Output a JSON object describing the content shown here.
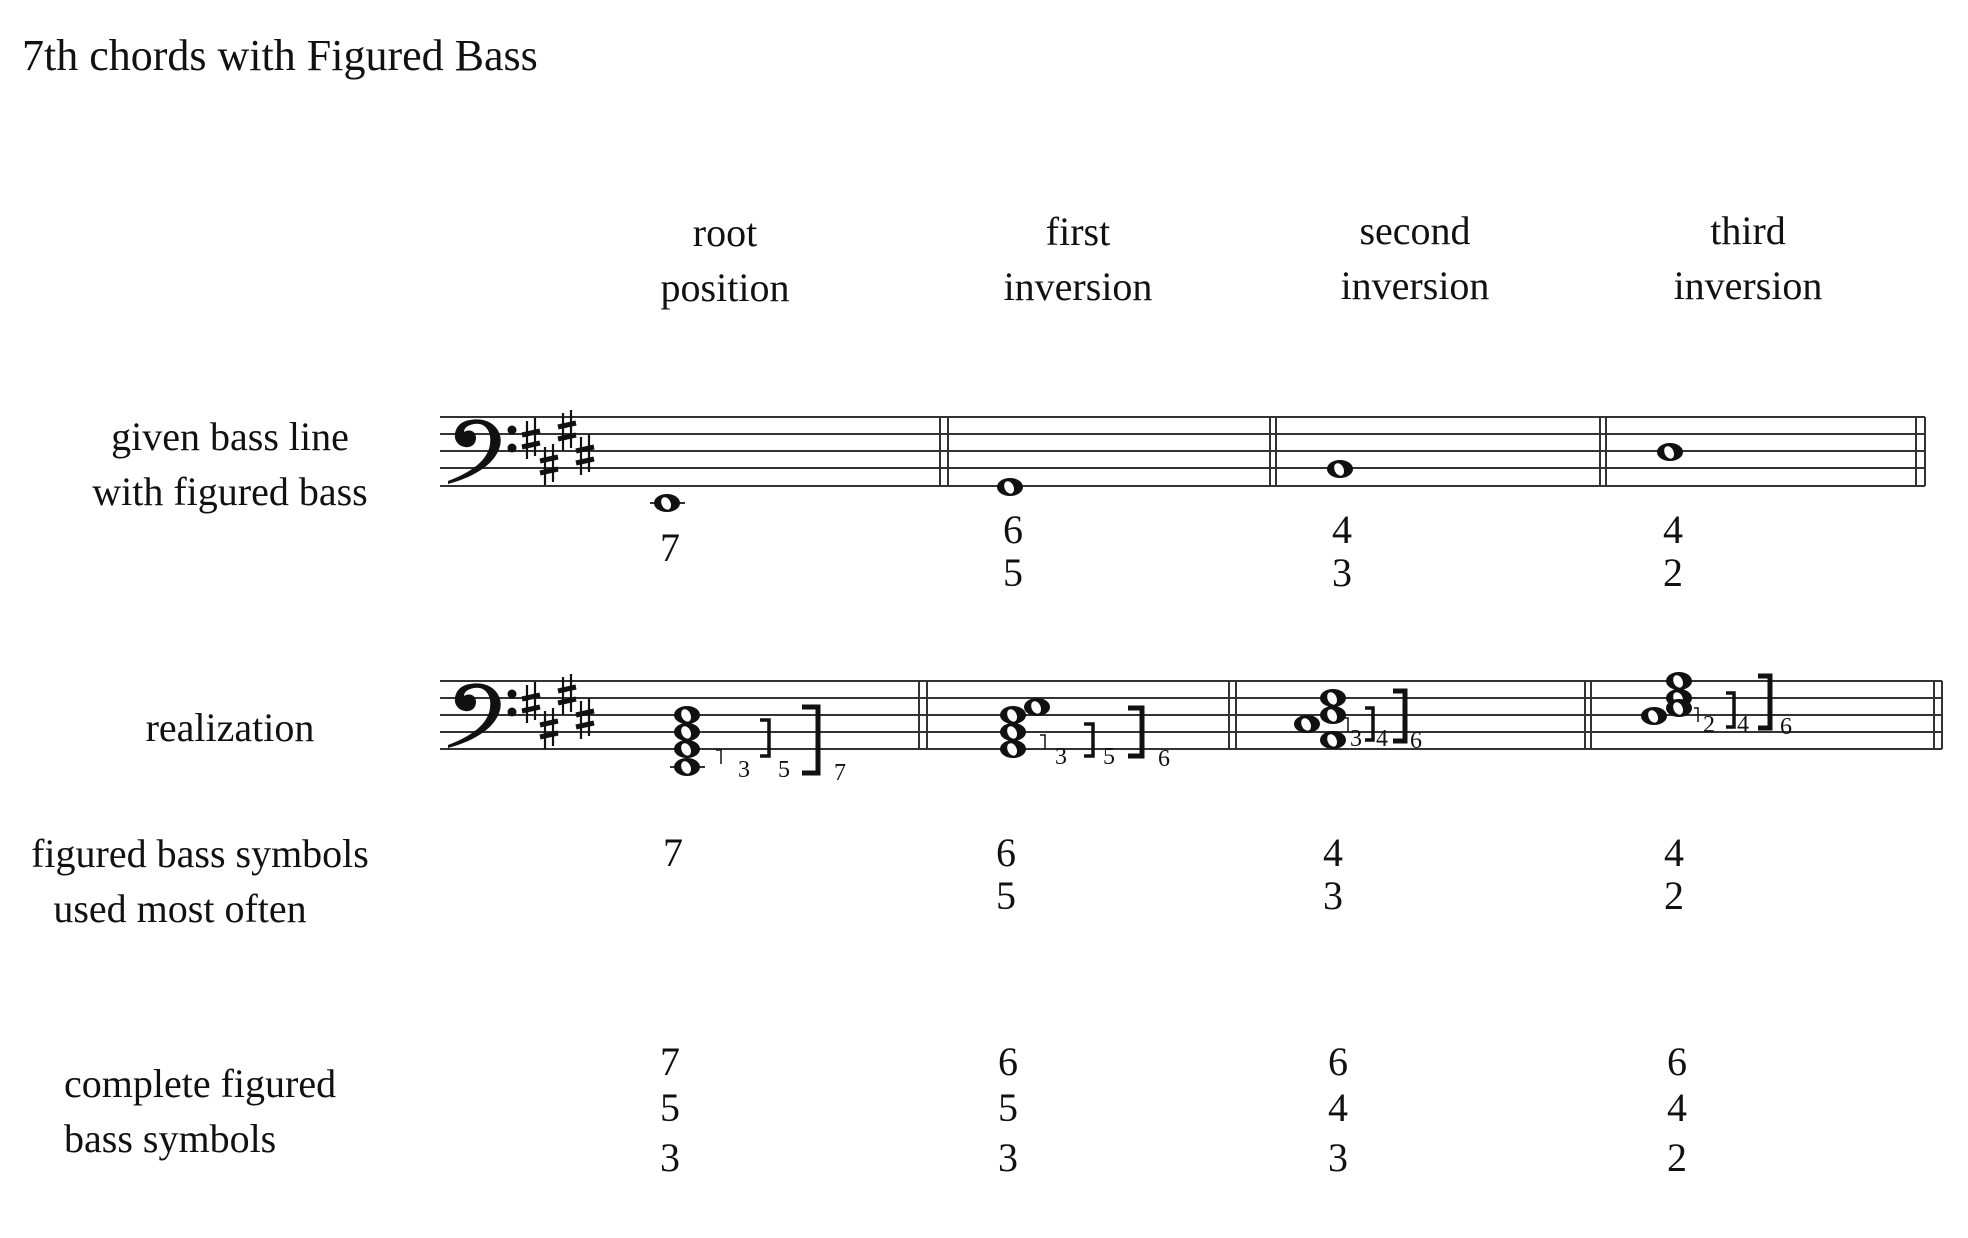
{
  "title": "7th chords with Figured Bass",
  "columns": [
    {
      "line1": "root",
      "line2": "position"
    },
    {
      "line1": "first",
      "line2": "inversion"
    },
    {
      "line1": "second",
      "line2": "inversion"
    },
    {
      "line1": "third",
      "line2": "inversion"
    }
  ],
  "rows": {
    "given": {
      "line1": "given bass line",
      "line2": "with figured bass"
    },
    "realization": {
      "line1": "realization"
    },
    "most_often": {
      "line1": "figured bass symbols",
      "line2": "used most often"
    },
    "complete": {
      "line1": "complete figured",
      "line2": "bass symbols"
    }
  },
  "clef": "bass-clef",
  "key_signature": "4 sharps (E major / C# minor)",
  "given_figures": [
    [
      "7"
    ],
    [
      "6",
      "5"
    ],
    [
      "4",
      "3"
    ],
    [
      "4",
      "2"
    ]
  ],
  "realization_intervals": [
    [
      "3",
      "5",
      "7"
    ],
    [
      "3",
      "5",
      "6"
    ],
    [
      "3",
      "4",
      "6"
    ],
    [
      "2",
      "4",
      "6"
    ]
  ],
  "most_often_figures": [
    [
      "7"
    ],
    [
      "6",
      "5"
    ],
    [
      "4",
      "3"
    ],
    [
      "4",
      "2"
    ]
  ],
  "complete_figures": [
    [
      "7",
      "5",
      "3"
    ],
    [
      "6",
      "5",
      "3"
    ],
    [
      "6",
      "4",
      "3"
    ],
    [
      "6",
      "4",
      "2"
    ]
  ]
}
